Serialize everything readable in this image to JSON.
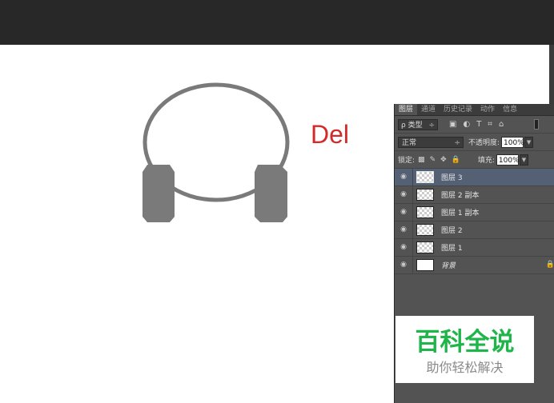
{
  "canvas": {
    "text": "Del",
    "text_color": "#d42a2a",
    "shape_color": "#7a7a7a"
  },
  "panel": {
    "tabs": [
      "图层",
      "通道",
      "历史记录",
      "动作",
      "信息"
    ],
    "filter": {
      "label": "ρ 类型",
      "arrow": "÷"
    },
    "filter_icons": [
      "▣",
      "◐",
      "T",
      "⌗",
      "⌂"
    ],
    "blend": {
      "value": "正常",
      "arrow": "÷"
    },
    "opacity": {
      "label": "不透明度:",
      "value": "100%"
    },
    "lock": {
      "label": "锁定:",
      "icons": [
        "▩",
        "✎",
        "✥",
        "🔒"
      ]
    },
    "fill": {
      "label": "填充:",
      "value": "100%"
    },
    "layers": [
      {
        "name": "图层 3",
        "selected": true
      },
      {
        "name": "图层 2 副本"
      },
      {
        "name": "图层 1 副本"
      },
      {
        "name": "图层 2"
      },
      {
        "name": "图层 1"
      },
      {
        "name": "背景",
        "background": true
      }
    ]
  },
  "watermark": {
    "line1": "百科全说",
    "line2": "助你轻松解决"
  }
}
